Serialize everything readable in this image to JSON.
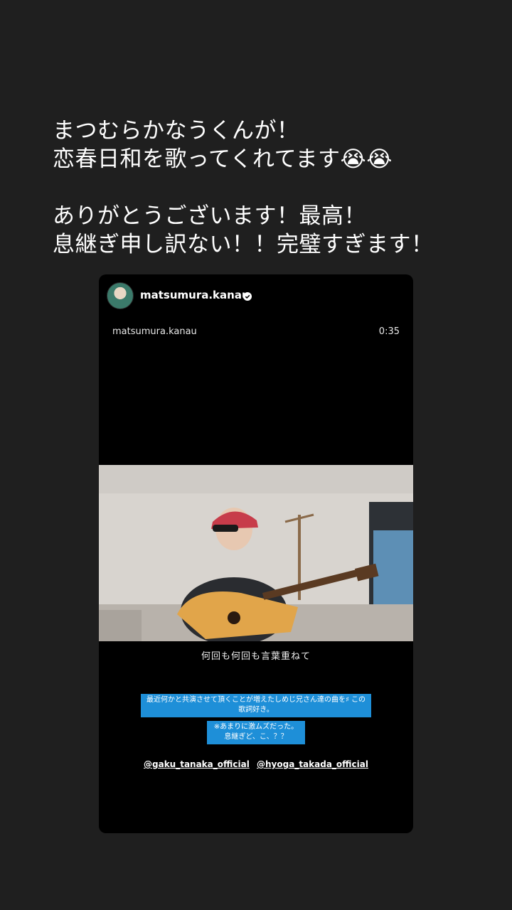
{
  "caption": {
    "line1": "まつむらかなうくんが！",
    "line2": "恋春日和を歌ってくれてます😭😭",
    "line3": "ありがとうございます！最高！",
    "line4": "息継ぎ申し訳ない！！完璧すぎます！"
  },
  "shared_post": {
    "username": "matsumura.kanau",
    "verified": true,
    "sub_username": "matsumura.kanau",
    "duration": "0:35",
    "lyric": "何回も何回も言葉重ねて",
    "sticker1": "最近何かと共演させて頂くことが増えたしめじ兄さん達の曲を♯ この歌詞好き。",
    "sticker2": "※あまりに激ムズだった。 息継ぎど、こ、？？",
    "mention1": "@gaku_tanaka_official",
    "mention2": "@hyoga_takada_official"
  },
  "colors": {
    "background": "#1f1f1f",
    "card": "#000000",
    "sticker": "#1e8fd8"
  }
}
